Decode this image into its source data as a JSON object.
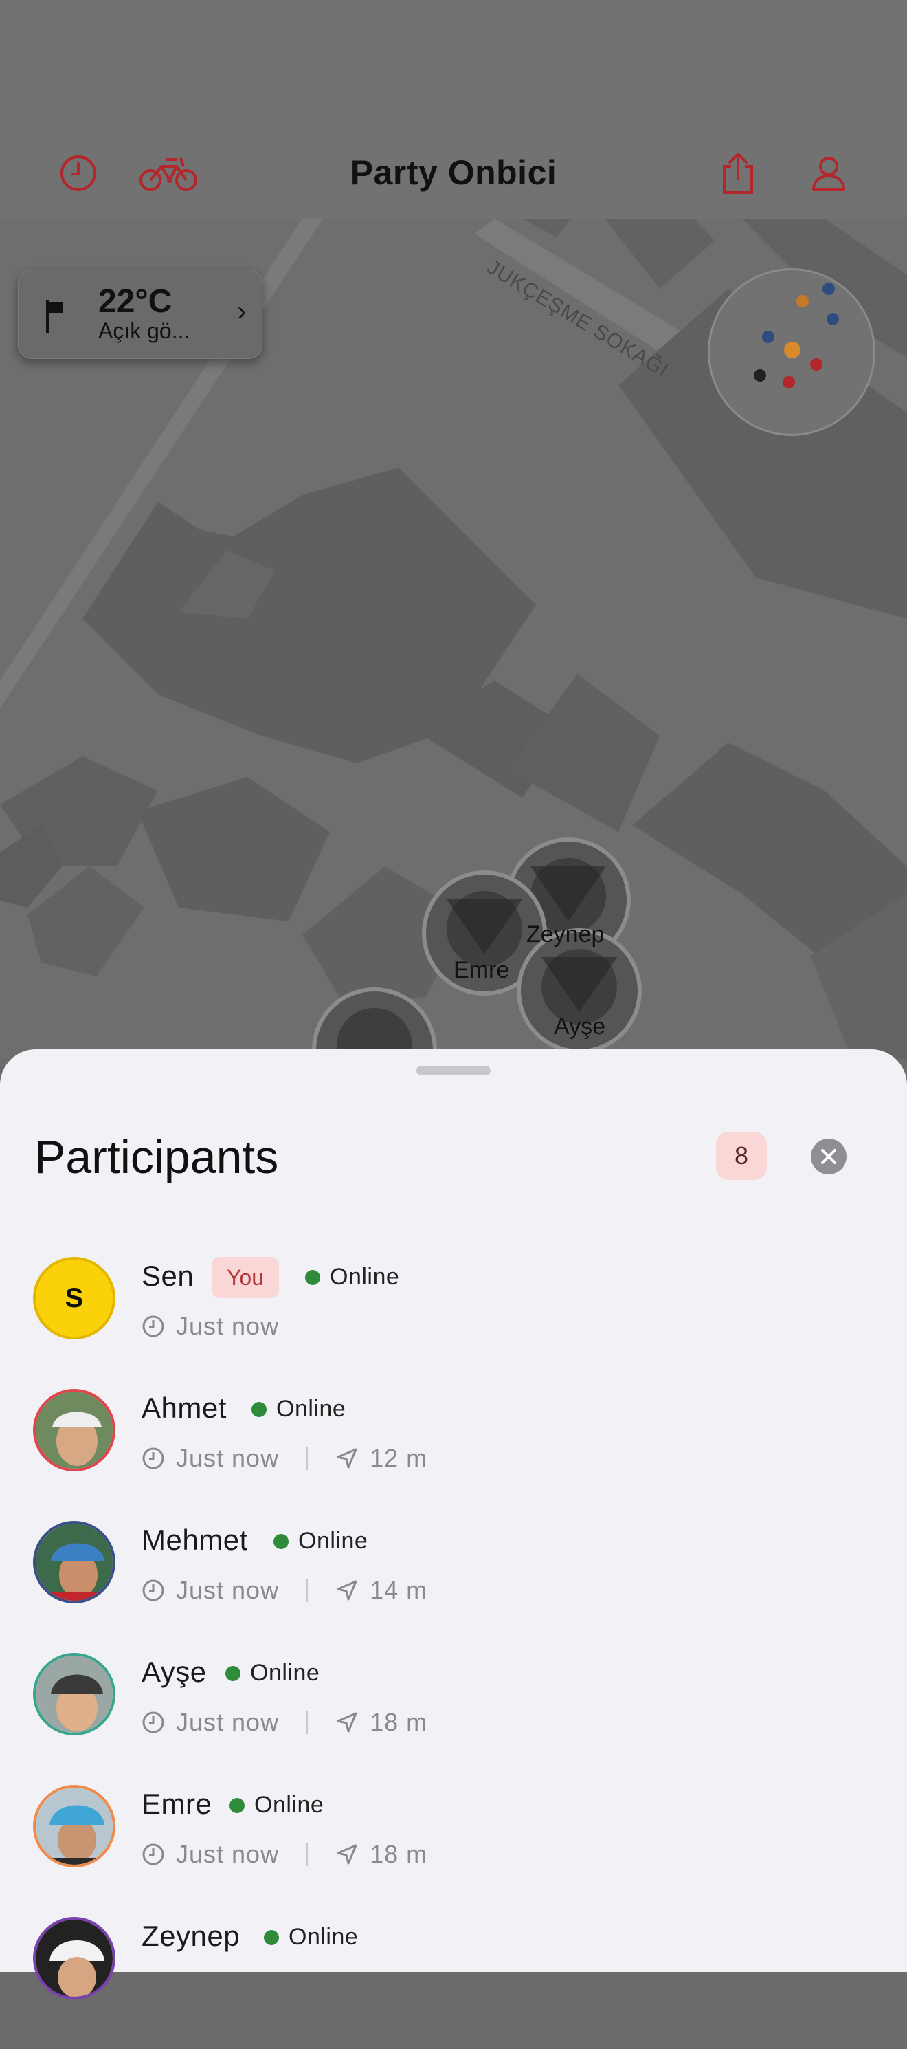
{
  "header": {
    "title": "Party Onbici",
    "icons": [
      "clock-icon",
      "bicycle-icon",
      "share-icon",
      "person-icon"
    ]
  },
  "map": {
    "street_name": "JUKÇEŞME SOKAĞI",
    "markers": [
      {
        "name": "Zeynep"
      },
      {
        "name": "Emre"
      },
      {
        "name": "Ayşe"
      }
    ]
  },
  "weather": {
    "temperature": "22°C",
    "description": "Açık gö..."
  },
  "sheet": {
    "title": "Participants",
    "count": "8"
  },
  "participants": [
    {
      "name": "Sen",
      "initial": "S",
      "you_label": "You",
      "status": "Online",
      "last_seen": "Just now",
      "distance": ""
    },
    {
      "name": "Ahmet",
      "status": "Online",
      "last_seen": "Just now",
      "distance": "12 m",
      "ring": "#e0454d"
    },
    {
      "name": "Mehmet",
      "status": "Online",
      "last_seen": "Just now",
      "distance": "14 m",
      "ring": "#3a4f86"
    },
    {
      "name": "Ayşe",
      "status": "Online",
      "last_seen": "Just now",
      "distance": "18 m",
      "ring": "#3aa58f"
    },
    {
      "name": "Emre",
      "status": "Online",
      "last_seen": "Just now",
      "distance": "18 m",
      "ring": "#f08a4b"
    },
    {
      "name": "Zeynep",
      "status": "Online",
      "last_seen": "",
      "distance": "",
      "ring": "#7a3fb0"
    }
  ],
  "colors": {
    "accent": "#b3262b",
    "online": "#2e8b3a",
    "badge_bg": "#fbd6d6"
  }
}
